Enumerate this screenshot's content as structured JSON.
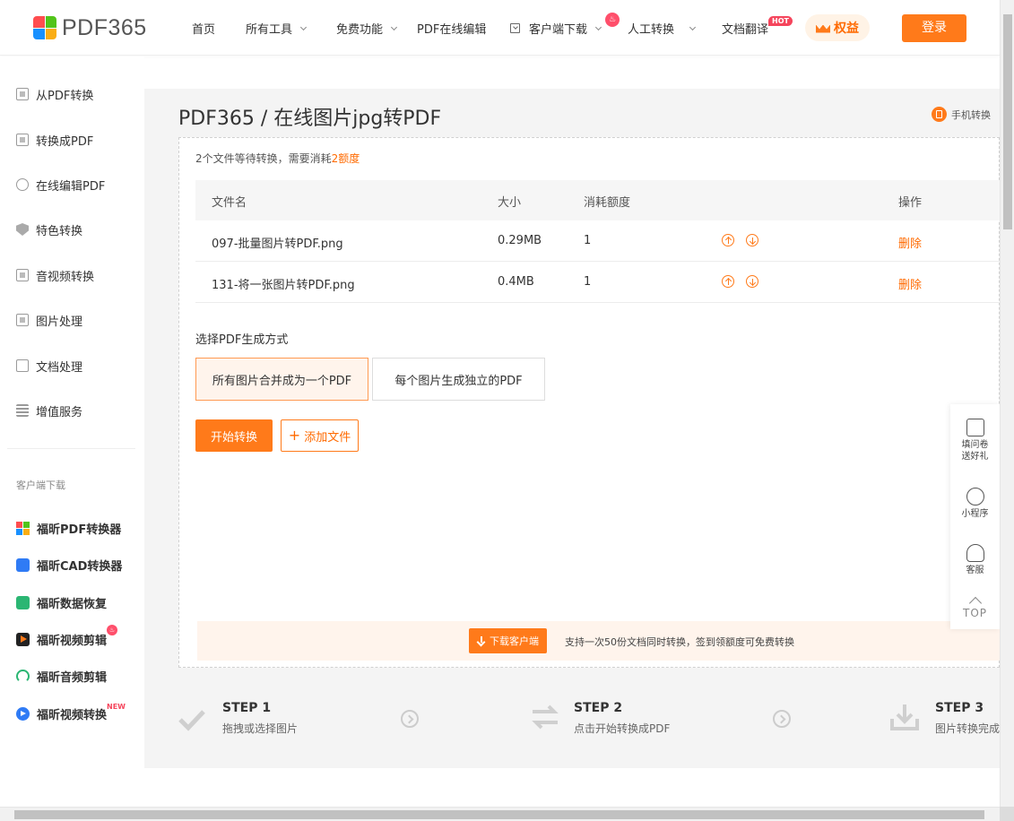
{
  "header": {
    "logo_text": "PDF365",
    "nav": {
      "home": "首页",
      "all_tools": "所有工具",
      "free": "免费功能",
      "online_edit": "PDF在线编辑",
      "client_download": "客户端下载",
      "manual": "人工转换",
      "translate": "文档翻译",
      "hot_badge": "HOT",
      "fire_badge": "♨"
    },
    "rights_label": "权益",
    "login_label": "登录"
  },
  "sidebar": {
    "items": [
      {
        "label": "从PDF转换",
        "icon": "pdf-convert-icon"
      },
      {
        "label": "转换成PDF",
        "icon": "to-pdf-icon"
      },
      {
        "label": "在线编辑PDF",
        "icon": "edit-pdf-icon"
      },
      {
        "label": "特色转换",
        "icon": "shield-icon"
      },
      {
        "label": "音视频转换",
        "icon": "media-icon"
      },
      {
        "label": "图片处理",
        "icon": "image-icon"
      },
      {
        "label": "文档处理",
        "icon": "document-icon"
      },
      {
        "label": "增值服务",
        "icon": "list-icon"
      }
    ],
    "section_title": "客户端下载",
    "apps": [
      {
        "label": "福昕PDF转换器"
      },
      {
        "label": "福昕CAD转换器"
      },
      {
        "label": "福昕数据恢复"
      },
      {
        "label": "福昕视频剪辑",
        "badge": "♨"
      },
      {
        "label": "福昕音频剪辑"
      },
      {
        "label": "福昕视频转换",
        "badge": "NEW"
      }
    ]
  },
  "page": {
    "title": "PDF365 / 在线图片jpg转PDF",
    "mobile_link": "手机转换"
  },
  "summary": {
    "prefix": "2个文件等待转换，需要消耗",
    "highlight": "2额度"
  },
  "table": {
    "headers": {
      "name": "文件名",
      "size": "大小",
      "quota": "消耗额度",
      "action": "操作"
    },
    "rows": [
      {
        "name": "097-批量图片转PDF.png",
        "size": "0.29MB",
        "quota": "1",
        "action": "删除"
      },
      {
        "name": "131-将一张图片转PDF.png",
        "size": "0.4MB",
        "quota": "1",
        "action": "删除"
      }
    ]
  },
  "mode": {
    "label": "选择PDF生成方式",
    "options": [
      "所有图片合并成为一个PDF",
      "每个图片生成独立的PDF"
    ],
    "selected": "所有图片合并成为一个PDF"
  },
  "buttons": {
    "start": "开始转换",
    "add": "添加文件"
  },
  "banner": {
    "download_label": "下载客户端",
    "text": "支持一次50份文档同时转换，签到领额度可免费转换"
  },
  "steps": [
    {
      "title": "STEP 1",
      "desc": "拖拽或选择图片"
    },
    {
      "title": "STEP 2",
      "desc": "点击开始转换成PDF"
    },
    {
      "title": "STEP 3",
      "desc": "图片转换完成"
    }
  ],
  "float_tools": {
    "survey": "填问卷送好礼",
    "miniprogram": "小程序",
    "service": "客服",
    "top": "TOP"
  },
  "colors": {
    "accent": "#ff7a1a",
    "accent_text": "#ff6a00",
    "hot": "#f5455c",
    "bg_gray": "#f4f4f4"
  }
}
